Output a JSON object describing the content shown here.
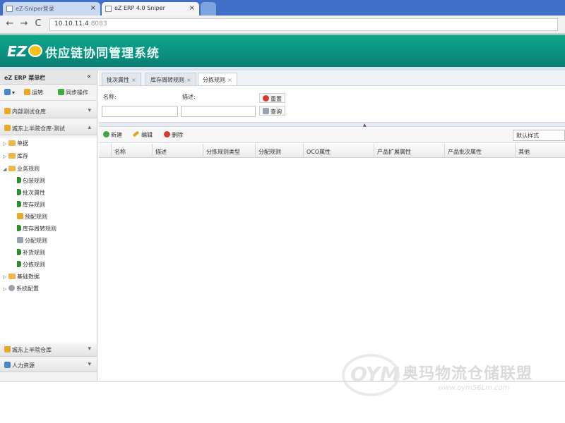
{
  "browser": {
    "tabs": [
      {
        "label": "eZ-Sniper登录",
        "active": false
      },
      {
        "label": "eZ ERP 4.0 Sniper",
        "active": true
      }
    ],
    "close_glyph": "×",
    "nav": {
      "back": "←",
      "forward": "→",
      "reload": "C"
    },
    "url": "10.10.11.4",
    "url_port": ":8083"
  },
  "app": {
    "logo_text": "EZ",
    "title": "供应链协同管理系统"
  },
  "sidebar": {
    "title": "eZ ERP 菜单栏",
    "toggle": "«",
    "tools": [
      {
        "label": "",
        "icon": "person-icon"
      },
      {
        "label": "运转",
        "icon": "lock-icon"
      },
      {
        "label": "同步操作",
        "icon": "sync-icon"
      }
    ],
    "groups_top": [
      {
        "label": "内部测试仓库",
        "expanded": false
      },
      {
        "label": "城东上半院仓库-测试",
        "expanded": true
      }
    ],
    "tree": [
      {
        "label": "单据",
        "level": 0,
        "arrow": "▷",
        "icon": "folder-icon"
      },
      {
        "label": "库存",
        "level": 0,
        "arrow": "▷",
        "icon": "folder-icon"
      },
      {
        "label": "业务规则",
        "level": 0,
        "arrow": "◢",
        "icon": "folder-icon"
      },
      {
        "label": "包装规则",
        "level": 1,
        "icon": "flag-icon"
      },
      {
        "label": "批次属性",
        "level": 1,
        "icon": "flag-icon"
      },
      {
        "label": "库存规则",
        "level": 1,
        "icon": "flag-icon"
      },
      {
        "label": "预配规则",
        "level": 1,
        "icon": "flag-icon"
      },
      {
        "label": "库存周转规则",
        "level": 1,
        "icon": "flag-icon"
      },
      {
        "label": "分配规则",
        "level": 1,
        "icon": "flag-icon"
      },
      {
        "label": "补货规则",
        "level": 1,
        "icon": "flag-icon"
      },
      {
        "label": "分拣规则",
        "level": 1,
        "icon": "flag-icon"
      },
      {
        "label": "基础数据",
        "level": 0,
        "arrow": "▷",
        "icon": "folder-icon"
      },
      {
        "label": "系统配置",
        "level": 0,
        "arrow": "▷",
        "icon": "gear-icon"
      }
    ],
    "groups_bottom": [
      {
        "label": "城东上半院仓库"
      },
      {
        "label": "人力资源"
      }
    ]
  },
  "page_tabs": [
    {
      "label": "批次属性",
      "active": false
    },
    {
      "label": "库存周转规则",
      "active": false
    },
    {
      "label": "分拣规则",
      "active": true
    }
  ],
  "tab_close": "×",
  "search": {
    "name_label": "名称:",
    "desc_label": "描述:",
    "name_value": "",
    "desc_value": "",
    "reset_button": "重置",
    "query_button": "查询"
  },
  "grid_toolbar": {
    "add": "新建",
    "edit": "编辑",
    "delete": "删除",
    "view_select": "默认样式"
  },
  "grid": {
    "columns": [
      "名称",
      "描述",
      "分拣规则类型",
      "分配规则",
      "OCO属性",
      "产品扩展属性",
      "产品批次属性",
      "其他"
    ],
    "rows": []
  },
  "watermark": {
    "mark": "OYM",
    "text": "奥玛物流仓储联盟",
    "url": "www.oym56Lm.com"
  },
  "colors": {
    "header_green": "#0b8f80",
    "browser_blue": "#3f6fc7"
  }
}
